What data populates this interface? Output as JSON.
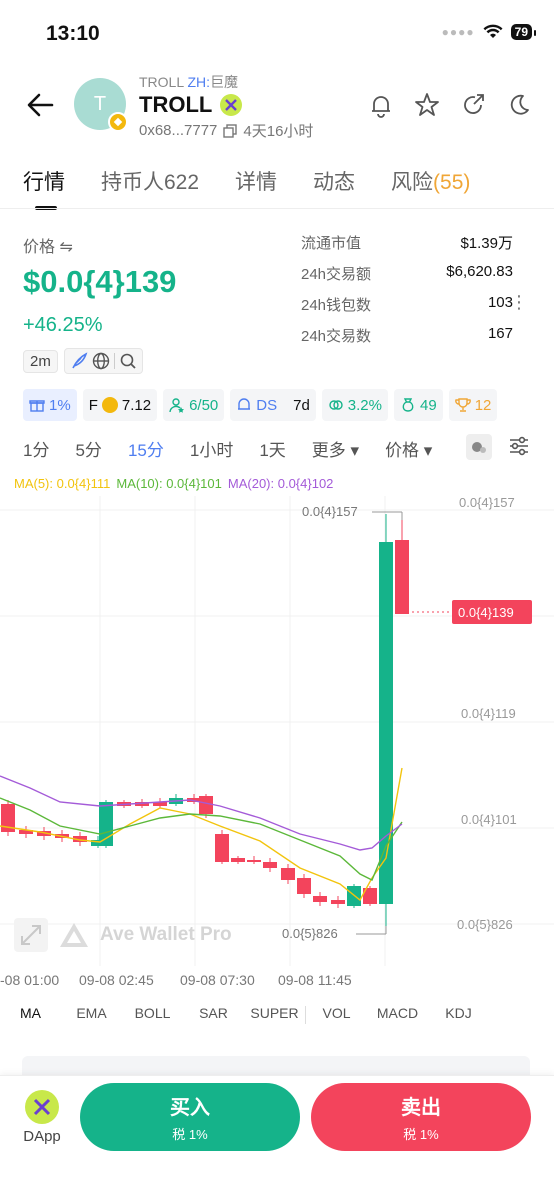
{
  "status": {
    "time": "13:10",
    "battery": "79"
  },
  "token": {
    "symbol_small": "TROLL",
    "zh_label": "ZH:",
    "zh_name": "巨魔",
    "name": "TROLL",
    "avatar_letter": "T",
    "address": "0x68...7777",
    "age": "4天16小时"
  },
  "tabs": [
    {
      "label": "行情"
    },
    {
      "label": "持币人622"
    },
    {
      "label": "详情"
    },
    {
      "label": "动态"
    },
    {
      "label": "风险",
      "badge": "(55)"
    }
  ],
  "price": {
    "label": "价格 ⇋",
    "value": "$0.0{4}139",
    "change": "+46.25%",
    "age_chip": "2m"
  },
  "stats": [
    {
      "k": "流通市值",
      "v": "$1.39万"
    },
    {
      "k": "24h交易额",
      "v": "$6,620.83"
    },
    {
      "k": "24h钱包数",
      "v": "103"
    },
    {
      "k": "24h交易数",
      "v": "167"
    }
  ],
  "metrics": {
    "gift": "1%",
    "f_label": "F",
    "f_value": "7.12",
    "users": "6/50",
    "ds": "DS",
    "ds_period": "7d",
    "bundle": "3.2%",
    "money": "49",
    "trophy": "12"
  },
  "intervals": [
    "1分",
    "5分",
    "15分",
    "1小时",
    "1天",
    "更多 ▾",
    "价格 ▾"
  ],
  "ma": {
    "ma5": "MA(5): 0.0{4}111",
    "ma10": "MA(10): 0.0{4}101",
    "ma20": "MA(20): 0.0{4}102"
  },
  "chart_data": {
    "type": "candlestick",
    "y_ticks": [
      "0.0{4}157",
      "0.0{4}139",
      "0.0{4}119",
      "0.0{4}101",
      "0.0{5}826"
    ],
    "current_price": "0.0{4}139",
    "high_label": "0.0{4}157",
    "low_label": "0.0{5}826",
    "x_labels": [
      "-08 01:00",
      "09-08 02:45",
      "09-08 07:30",
      "09-08 11:45"
    ],
    "watermark": "Ave Wallet Pro"
  },
  "indicators": [
    "MA",
    "EMA",
    "BOLL",
    "SAR",
    "SUPER",
    "VOL",
    "MACD",
    "KDJ"
  ],
  "actions": {
    "dapp": "DApp",
    "buy": "买入",
    "buy_tax": "税 1%",
    "sell": "卖出",
    "sell_tax": "税 1%"
  },
  "colors": {
    "up": "#15b38a",
    "down": "#f3445c",
    "accent": "#4f7ef0",
    "ma5": "#f2c40e",
    "ma10": "#5cb83a",
    "ma20": "#a45bd8"
  }
}
